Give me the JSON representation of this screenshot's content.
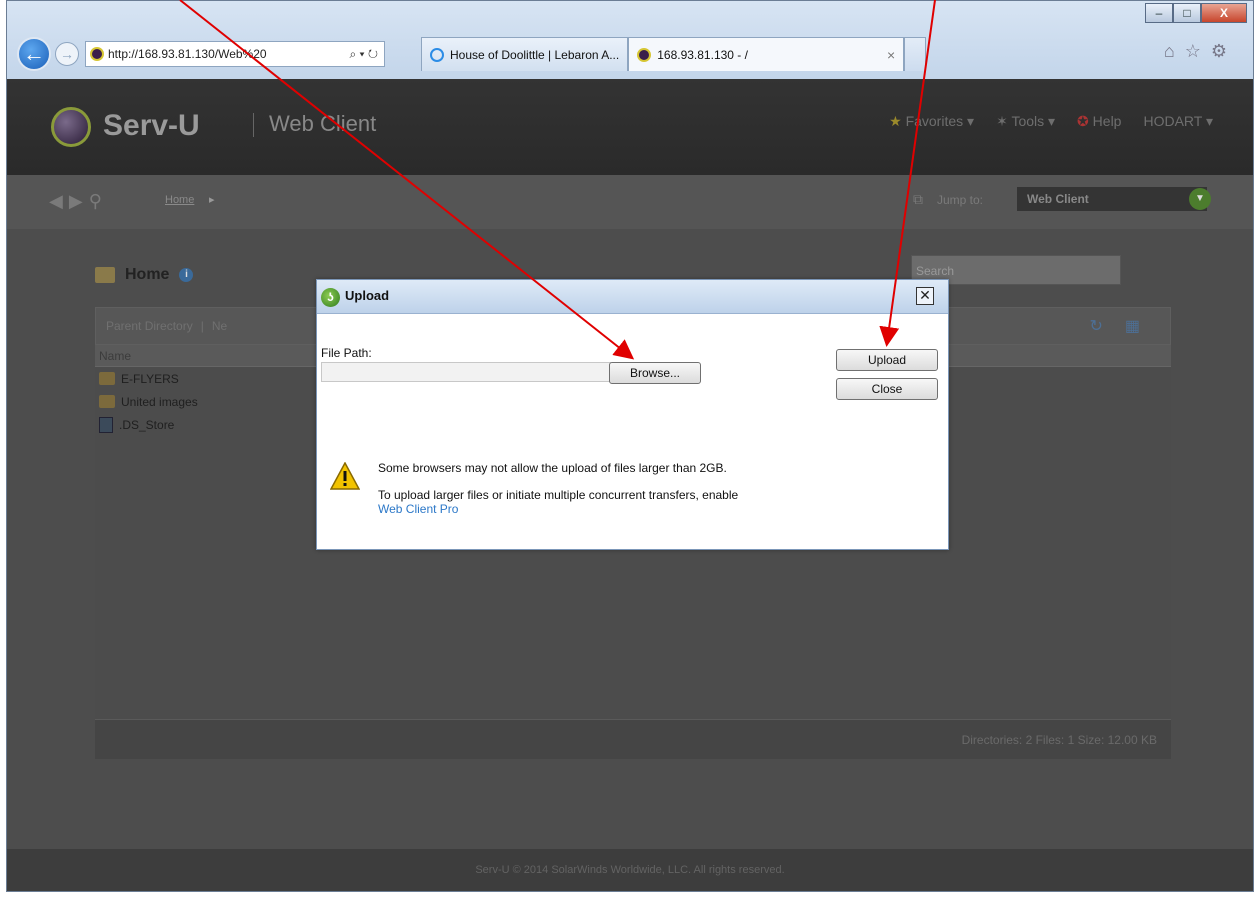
{
  "browser": {
    "address_url": "http://168.93.81.130/Web%20",
    "address_tools": "⌕ ▾ ↻",
    "tabs": [
      {
        "label": "House of Doolittle | Lebaron A..."
      },
      {
        "label": "168.93.81.130 - /",
        "close": "×"
      }
    ],
    "window_controls": {
      "minimize": "–",
      "maximize": "□",
      "close": "X"
    },
    "icons": {
      "home": "⌂",
      "favorites": "☆",
      "settings": "⚙"
    }
  },
  "app": {
    "brand": "Serv-U",
    "sub_brand": "Web Client",
    "menu": [
      "Favorites ▾",
      "Tools ▾",
      "Help",
      "HODART ▾"
    ],
    "breadcrumb": "Home",
    "jump_label": "Jump to:",
    "jump_value": "Web Client",
    "folder_title": "Home",
    "search_placeholder": "Search",
    "toolbar_labels": [
      "Parent Directory",
      "Ne"
    ],
    "column_name": "Name",
    "files": [
      {
        "name": "E-FLYERS",
        "type": "folder"
      },
      {
        "name": "United images",
        "type": "folder"
      },
      {
        "name": ".DS_Store",
        "type": "file"
      }
    ],
    "status": "Directories: 2   Files: 1   Size: 12.00 KB",
    "footer": "Serv-U © 2014 SolarWinds Worldwide, LLC. All rights reserved."
  },
  "dialog": {
    "title": "Upload",
    "close_glyph": "✕",
    "file_path_label": "File Path:",
    "file_path_value": "",
    "browse_label": "Browse...",
    "upload_label": "Upload",
    "close_label": "Close",
    "warning_line1": "Some browsers may not allow the upload of files larger than 2GB.",
    "warning_line2": "To upload larger files or initiate multiple concurrent transfers, enable",
    "pro_link": "Web Client Pro"
  },
  "annotations": {
    "arrow_color": "#e00000"
  }
}
